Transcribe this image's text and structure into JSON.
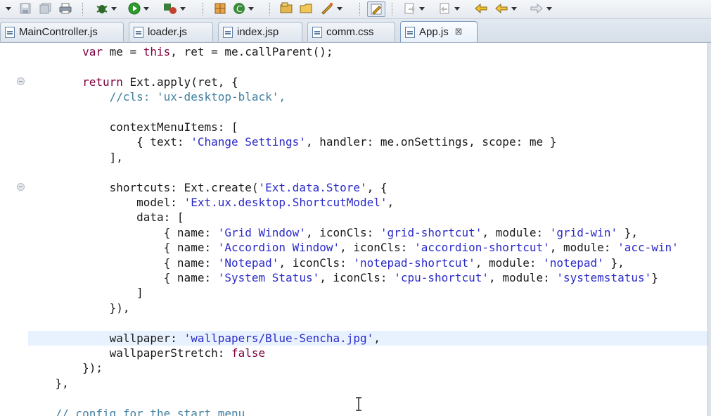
{
  "toolbar": {
    "icons": [
      "save-icon",
      "save-all-icon",
      "print-icon",
      "debug-icon",
      "run-icon",
      "external-tools-icon",
      "new-package-icon",
      "new-class-icon",
      "open-type-icon",
      "open-folder-icon",
      "search-icon",
      "toggle-mark-occurrences-icon",
      "next-annotation-icon",
      "previous-annotation-icon",
      "back-icon",
      "forward-icon"
    ]
  },
  "tabs": [
    {
      "label": "MainController.js"
    },
    {
      "label": "loader.js"
    },
    {
      "label": "index.jsp"
    },
    {
      "label": "comm.css"
    },
    {
      "label": "App.js",
      "close": "⊠"
    }
  ],
  "editor": {
    "lines": [
      {
        "segments": [
          {
            "t": "        "
          },
          {
            "t": "var",
            "c": "kw"
          },
          {
            "t": " me = "
          },
          {
            "t": "this",
            "c": "kw"
          },
          {
            "t": ", ret = me.callParent();"
          }
        ]
      },
      {
        "segments": [
          {
            "t": ""
          }
        ]
      },
      {
        "segments": [
          {
            "t": "        "
          },
          {
            "t": "return",
            "c": "kw"
          },
          {
            "t": " Ext.apply(ret, {"
          }
        ]
      },
      {
        "segments": [
          {
            "t": "            "
          },
          {
            "t": "//cls: 'ux-desktop-black',",
            "c": "cm"
          }
        ]
      },
      {
        "segments": [
          {
            "t": ""
          }
        ]
      },
      {
        "segments": [
          {
            "t": "            contextMenuItems: ["
          }
        ]
      },
      {
        "segments": [
          {
            "t": "                { text: "
          },
          {
            "t": "'Change Settings'",
            "c": "str"
          },
          {
            "t": ", handler: me.onSettings, scope: me }"
          }
        ]
      },
      {
        "segments": [
          {
            "t": "            ],"
          }
        ]
      },
      {
        "segments": [
          {
            "t": ""
          }
        ]
      },
      {
        "segments": [
          {
            "t": "            shortcuts: Ext.create("
          },
          {
            "t": "'Ext.data.Store'",
            "c": "str"
          },
          {
            "t": ", {"
          }
        ]
      },
      {
        "segments": [
          {
            "t": "                model: "
          },
          {
            "t": "'Ext.ux.desktop.ShortcutModel'",
            "c": "str"
          },
          {
            "t": ","
          }
        ]
      },
      {
        "segments": [
          {
            "t": "                data: ["
          }
        ]
      },
      {
        "segments": [
          {
            "t": "                    { name: "
          },
          {
            "t": "'Grid Window'",
            "c": "str"
          },
          {
            "t": ", iconCls: "
          },
          {
            "t": "'grid-shortcut'",
            "c": "str"
          },
          {
            "t": ", module: "
          },
          {
            "t": "'grid-win'",
            "c": "str"
          },
          {
            "t": " },"
          }
        ]
      },
      {
        "segments": [
          {
            "t": "                    { name: "
          },
          {
            "t": "'Accordion Window'",
            "c": "str"
          },
          {
            "t": ", iconCls: "
          },
          {
            "t": "'accordion-shortcut'",
            "c": "str"
          },
          {
            "t": ", module: "
          },
          {
            "t": "'acc-win'",
            "c": "str"
          }
        ]
      },
      {
        "segments": [
          {
            "t": "                    { name: "
          },
          {
            "t": "'Notepad'",
            "c": "str"
          },
          {
            "t": ", iconCls: "
          },
          {
            "t": "'notepad-shortcut'",
            "c": "str"
          },
          {
            "t": ", module: "
          },
          {
            "t": "'notepad'",
            "c": "str"
          },
          {
            "t": " },"
          }
        ]
      },
      {
        "segments": [
          {
            "t": "                    { name: "
          },
          {
            "t": "'System Status'",
            "c": "str"
          },
          {
            "t": ", iconCls: "
          },
          {
            "t": "'cpu-shortcut'",
            "c": "str"
          },
          {
            "t": ", module: "
          },
          {
            "t": "'systemstatus'",
            "c": "str"
          },
          {
            "t": "}"
          }
        ]
      },
      {
        "segments": [
          {
            "t": "                ]"
          }
        ]
      },
      {
        "segments": [
          {
            "t": "            }),"
          }
        ]
      },
      {
        "segments": [
          {
            "t": ""
          }
        ]
      },
      {
        "segments": [
          {
            "t": "            wallpaper: "
          },
          {
            "t": "'wallpapers/Blue-Sencha.jpg'",
            "c": "str"
          },
          {
            "t": ","
          }
        ]
      },
      {
        "segments": [
          {
            "t": "            wallpaperStretch: "
          },
          {
            "t": "false",
            "c": "kw"
          }
        ]
      },
      {
        "segments": [
          {
            "t": "        });"
          }
        ]
      },
      {
        "segments": [
          {
            "t": "    },"
          }
        ]
      },
      {
        "segments": [
          {
            "t": ""
          }
        ]
      },
      {
        "segments": [
          {
            "t": "    "
          },
          {
            "t": "// config for the start menu",
            "c": "cm"
          }
        ]
      }
    ]
  },
  "colors": {
    "keyword": "#800040",
    "string": "#2a2ac8",
    "comment": "#3f7f9f",
    "current_line": "#e8f2fe"
  }
}
